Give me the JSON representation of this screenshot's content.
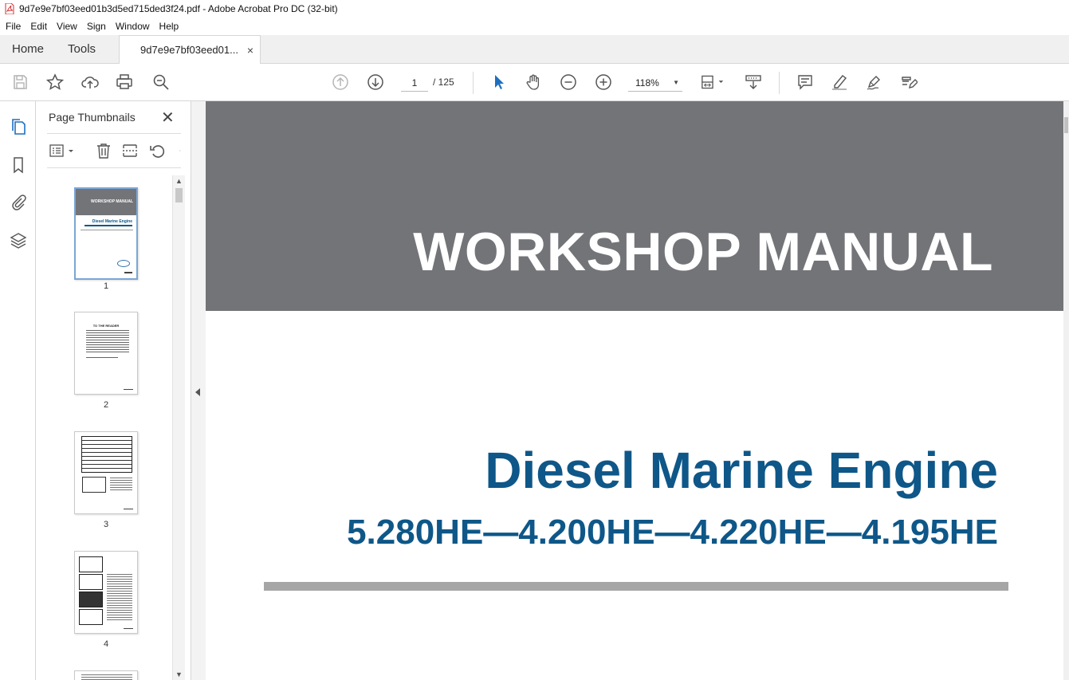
{
  "window": {
    "title": "9d7e9e7bf03eed01b3d5ed715ded3f24.pdf - Adobe Acrobat Pro DC (32-bit)"
  },
  "menu": [
    "File",
    "Edit",
    "View",
    "Sign",
    "Window",
    "Help"
  ],
  "tabs": {
    "home": "Home",
    "tools": "Tools",
    "document": "9d7e9e7bf03eed01...",
    "close": "×"
  },
  "toolbar": {
    "current_page": "1",
    "page_total": "/ 125",
    "zoom": "118%"
  },
  "thumbnails_panel": {
    "title": "Page Thumbnails",
    "close": "✕",
    "pages": [
      {
        "number": "1",
        "selected": true
      },
      {
        "number": "2",
        "selected": false
      },
      {
        "number": "3",
        "selected": false
      },
      {
        "number": "4",
        "selected": false
      }
    ],
    "thumb1": {
      "banner": "WORKSHOP MANUAL",
      "heading": "Diesel Marine Engine"
    },
    "thumb2": {
      "heading": "TO THE READER"
    }
  },
  "document": {
    "banner_title": "WORKSHOP MANUAL",
    "heading": "Diesel Marine Engine",
    "models": "5.280HE—4.200HE—4.220HE—4.195HE"
  },
  "colors": {
    "banner": "#737478",
    "heading": "#0e5788",
    "rule": "#a6a6a6",
    "accent_blue": "#1f6fbf"
  }
}
